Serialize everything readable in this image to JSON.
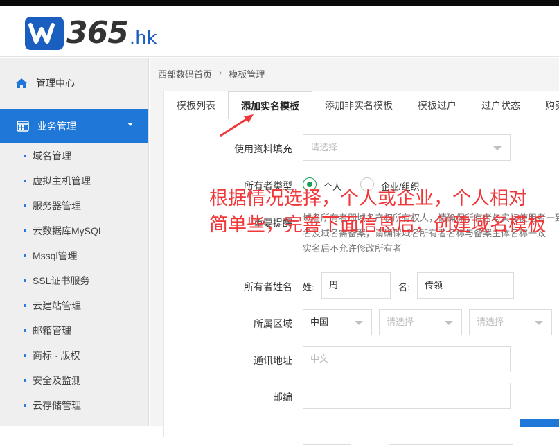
{
  "colors": {
    "brand": "#1a5fc0",
    "accent": "#1f78d8",
    "annotation": "#f0383b",
    "radio_on": "#1aa055"
  },
  "header": {
    "logo_text": "365",
    "logo_suffix": ".hk",
    "logo_icon": "w-logo-icon"
  },
  "sidebar": {
    "home_label": "管理中心",
    "home_icon": "home-icon",
    "active_label": "业务管理",
    "active_icon": "grid-icon",
    "items": [
      "域名管理",
      "虚拟主机管理",
      "服务器管理",
      "云数据库MySQL",
      "Mssql管理",
      "SSL证书服务",
      "云建站管理",
      "邮箱管理",
      "商标 · 版权",
      "安全及监测",
      "云存储管理"
    ]
  },
  "breadcrumb": {
    "home": "西部数码首页",
    "sep": "›",
    "current": "模板管理"
  },
  "tabs": [
    "模板列表",
    "添加实名模板",
    "添加非实名模板",
    "模板过户",
    "过户状态",
    "购买"
  ],
  "form": {
    "fill_label": "使用资料填充",
    "fill_placeholder": "请选择",
    "owner_type_label": "所有者类型",
    "owner_type_personal": "个人",
    "owner_type_company": "企业/组织",
    "notice_label": "重要提醒",
    "notice_line1": "域名所有者即域名产权所有权人，请确保所有者与实际使用者一致",
    "notice_line2": "名及域名需备案，请确保域名所有者名称与备案主体名称一致",
    "notice_line3": "实名后不允许修改所有者",
    "name_label": "所有者姓名",
    "surname_label": "姓:",
    "surname_value": "周",
    "given_label": "名:",
    "given_value": "传领",
    "region_label": "所属区域",
    "region_country": "中国",
    "region_province": "请选择",
    "region_city": "请选择",
    "address_label": "通讯地址",
    "address_placeholder": "中文",
    "postcode_label": "邮编"
  },
  "annotation": {
    "line1": "根据情况选择，个人或企业，个人相对",
    "line2": "简单些，完善下面信息后，创建域名模板"
  }
}
